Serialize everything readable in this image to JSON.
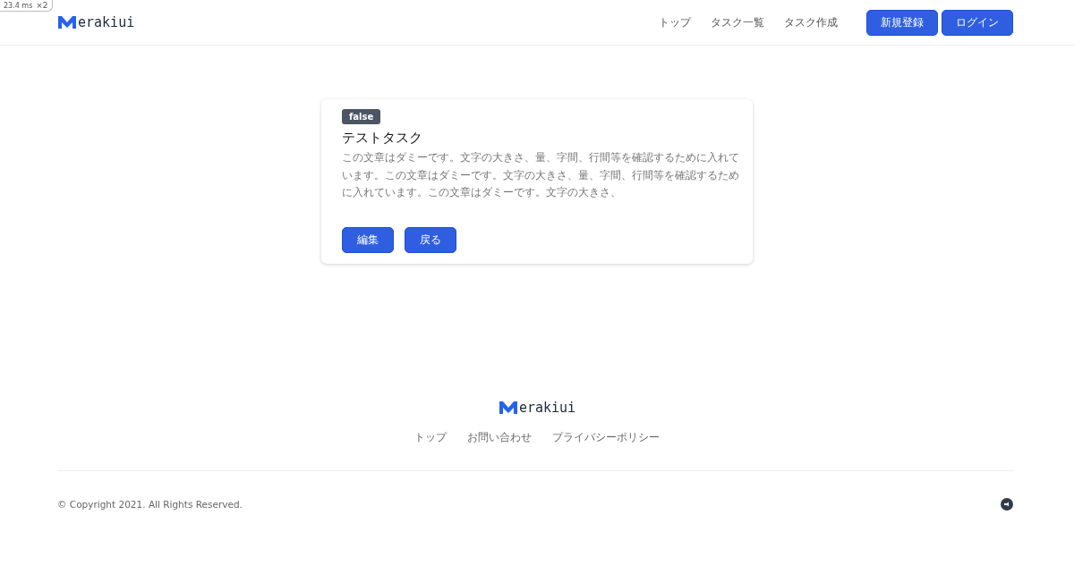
{
  "perf_badge": {
    "time": "23.4 ms",
    "count": "×2"
  },
  "header": {
    "logo_text": "erakiui",
    "nav": [
      {
        "label": "トップ"
      },
      {
        "label": "タスク一覧"
      },
      {
        "label": "タスク作成"
      }
    ],
    "buttons": [
      {
        "label": "新規登録"
      },
      {
        "label": "ログイン"
      }
    ]
  },
  "task": {
    "status": "false",
    "title": "テストタスク",
    "description": "この文章はダミーです。文字の大きさ、量、字間、行間等を確認するために入れています。この文章はダミーです。文字の大きさ、量、字間、行間等を確認するために入れています。この文章はダミーです。文字の大きさ、",
    "buttons": [
      {
        "label": "編集"
      },
      {
        "label": "戻る"
      }
    ]
  },
  "footer": {
    "logo_text": "erakiui",
    "links": [
      {
        "label": "トップ"
      },
      {
        "label": "お問い合わせ"
      },
      {
        "label": "プライバシーポリシー"
      }
    ],
    "copyright": "© Copyright 2021. All Rights Reserved."
  }
}
